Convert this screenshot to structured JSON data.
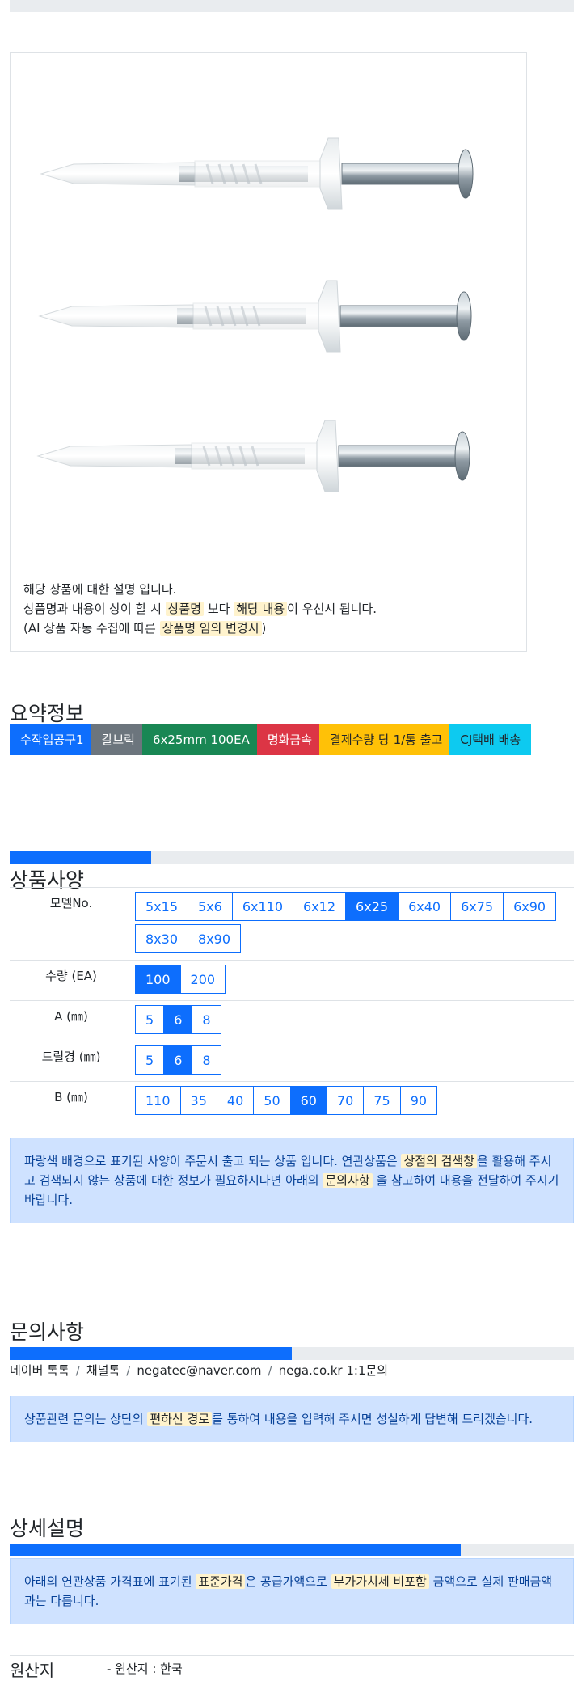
{
  "photo": {
    "note": {
      "line1": "해당 상품에 대한 설명 입니다.",
      "line2_a": "상품명과 내용이 상이 할 시 ",
      "line2_hl1": "상품명",
      "line2_b": " 보다 ",
      "line2_hl2": "해당 내용",
      "line2_c": "이 우선시 됩니다.",
      "line3_a": "(AI 상품 자동 수집에 따른 ",
      "line3_hl": "상품명 임의 변경시",
      "line3_b": ")"
    }
  },
  "summary": {
    "title": "요약정보",
    "tags": [
      {
        "label": "수작업공구1",
        "color": "#0d6efd",
        "text": "#ffffff"
      },
      {
        "label": "칼브럭",
        "color": "#6c757d",
        "text": "#ffffff"
      },
      {
        "label": "6x25mm 100EA",
        "color": "#198754",
        "text": "#ffffff"
      },
      {
        "label": "명화금속",
        "color": "#dc3545",
        "text": "#ffffff"
      },
      {
        "label": "결제수량 당 1/통 출고",
        "color": "#ffc107",
        "text": "#212529"
      },
      {
        "label": "CJ택배 배송",
        "color": "#0dcaf0",
        "text": "#212529"
      }
    ]
  },
  "spec": {
    "title": "상품사양",
    "progress": 0.25,
    "rows": [
      {
        "label": "모델No.",
        "options": [
          "5x15",
          "5x6",
          "6x110",
          "6x12",
          "6x25",
          "6x40",
          "6x75",
          "6x90",
          "8x30",
          "8x90"
        ],
        "selected": "6x25"
      },
      {
        "label": "수량 (EA)",
        "options": [
          "100",
          "200"
        ],
        "selected": "100"
      },
      {
        "label": "A (㎜)",
        "options": [
          "5",
          "6",
          "8"
        ],
        "selected": "6"
      },
      {
        "label": "드릴경 (㎜)",
        "options": [
          "5",
          "6",
          "8"
        ],
        "selected": "6"
      },
      {
        "label": "B (㎜)",
        "options": [
          "110",
          "35",
          "40",
          "50",
          "60",
          "70",
          "75",
          "90"
        ],
        "selected": "60"
      }
    ],
    "notice": {
      "a": "파랑색 배경으로 표기된 사양이 주문시 출고 되는 상품 입니다. 연관상품은 ",
      "hl1": "상점의 검색창",
      "b": "을 활용해 주시고 검색되지 않는 상품에 대한 정보가 필요하시다면 아래의 ",
      "hl2": "문의사항",
      "c": " 을 참고하여 내용을 전달하여 주시기 바랍니다."
    }
  },
  "inquiry": {
    "title": "문의사항",
    "progress": 0.5,
    "channels": [
      "네이버 톡톡",
      "채널톡",
      "negatec@naver.com",
      "nega.co.kr 1:1문의"
    ],
    "notice": {
      "a": "상품관련 문의는 상단의 ",
      "hl": "편하신 경로",
      "b": "를 통하여 내용을 입력해 주시면 성실하게 답변해 드리겠습니다."
    }
  },
  "detail": {
    "title": "상세설명",
    "progress": 0.8,
    "notice": {
      "a": "아래의 연관상품 가격표에 표기된 ",
      "hl1": "표준가격",
      "b": "은 공급가액으로 ",
      "hl2": "부가가치세 비포함",
      "c": " 금액으로 실제 판매금액과는 다릅니다."
    }
  },
  "origin": {
    "label": "원산지",
    "value": "- 원산지 : 한국"
  }
}
